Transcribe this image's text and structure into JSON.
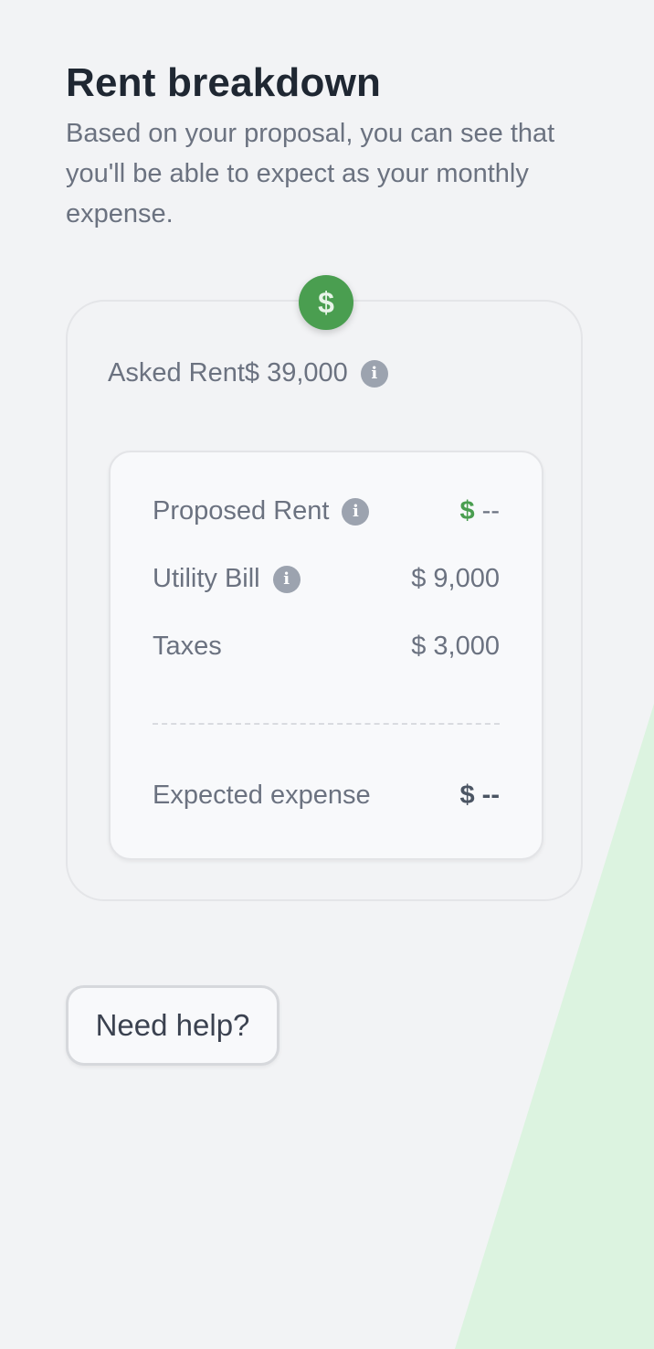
{
  "header": {
    "title": "Rent breakdown",
    "subtitle": "Based on your proposal, you can see that you'll be able to expect as your monthly expense."
  },
  "badge": {
    "symbol": "$",
    "icon": "dollar-icon",
    "color": "#4a9e50"
  },
  "asked_rent": {
    "label": "Asked Rent",
    "value": "$ 39,000",
    "info_icon": "info-icon"
  },
  "breakdown": {
    "proposed_rent": {
      "label": "Proposed Rent",
      "currency": "$",
      "value": "--"
    },
    "utility_bill": {
      "label": "Utility Bill",
      "value": "$ 9,000"
    },
    "taxes": {
      "label": "Taxes",
      "value": "$ 3,000"
    },
    "expected_expense": {
      "label": "Expected expense",
      "value": "$ --"
    }
  },
  "help": {
    "label": "Need help?"
  },
  "colors": {
    "accent_green": "#4a9e50",
    "background": "#f2f3f5",
    "decor_green": "#dcf3e0"
  }
}
